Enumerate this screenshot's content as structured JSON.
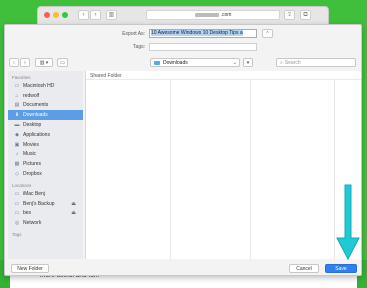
{
  "browser": {
    "url_suffix": ".com",
    "back_icon": "chevron-left-icon",
    "forward_icon": "chevron-right-icon",
    "sidebar_icon": "sidebar-icon",
    "share_icon": "share-icon",
    "tabs_icon": "tabs-icon"
  },
  "dialog": {
    "export_as_label": "Export As:",
    "export_as_value": "10 Awesome Windows 10 Desktop Tips a",
    "tags_label": "Tags:",
    "location": "Downloads",
    "search_placeholder": "Search",
    "column_header": "Shared Folder",
    "new_folder_label": "New Folder",
    "cancel_label": "Cancel",
    "save_label": "Save"
  },
  "sidebar": {
    "favorites_heading": "Favorites",
    "favorites": [
      {
        "label": "Macintosh HD",
        "icon": "hard-drive-icon",
        "selected": false
      },
      {
        "label": "redwolf",
        "icon": "home-icon",
        "selected": false
      },
      {
        "label": "Documents",
        "icon": "document-icon",
        "selected": false
      },
      {
        "label": "Downloads",
        "icon": "download-icon",
        "selected": true
      },
      {
        "label": "Desktop",
        "icon": "desktop-icon",
        "selected": false
      },
      {
        "label": "Applications",
        "icon": "applications-icon",
        "selected": false
      },
      {
        "label": "Movies",
        "icon": "movies-icon",
        "selected": false
      },
      {
        "label": "Music",
        "icon": "music-icon",
        "selected": false
      },
      {
        "label": "Pictures",
        "icon": "pictures-icon",
        "selected": false
      },
      {
        "label": "Dropbox",
        "icon": "dropbox-icon",
        "selected": false
      }
    ],
    "locations_heading": "Locations",
    "locations": [
      {
        "label": "iMac Benj",
        "icon": "computer-icon",
        "eject": false
      },
      {
        "label": "Benj's Backup",
        "icon": "drive-icon",
        "eject": true
      },
      {
        "label": "bes",
        "icon": "drive-icon",
        "eject": true
      },
      {
        "label": "Network",
        "icon": "network-icon",
        "eject": false
      }
    ],
    "tags_heading": "Tags"
  },
  "page_below": {
    "line2": "more useful and fun."
  },
  "colors": {
    "background": "#3fbf3c",
    "accent": "#2f7ff0",
    "selected": "#5c9de6",
    "arrow": "#1fc9d6"
  }
}
